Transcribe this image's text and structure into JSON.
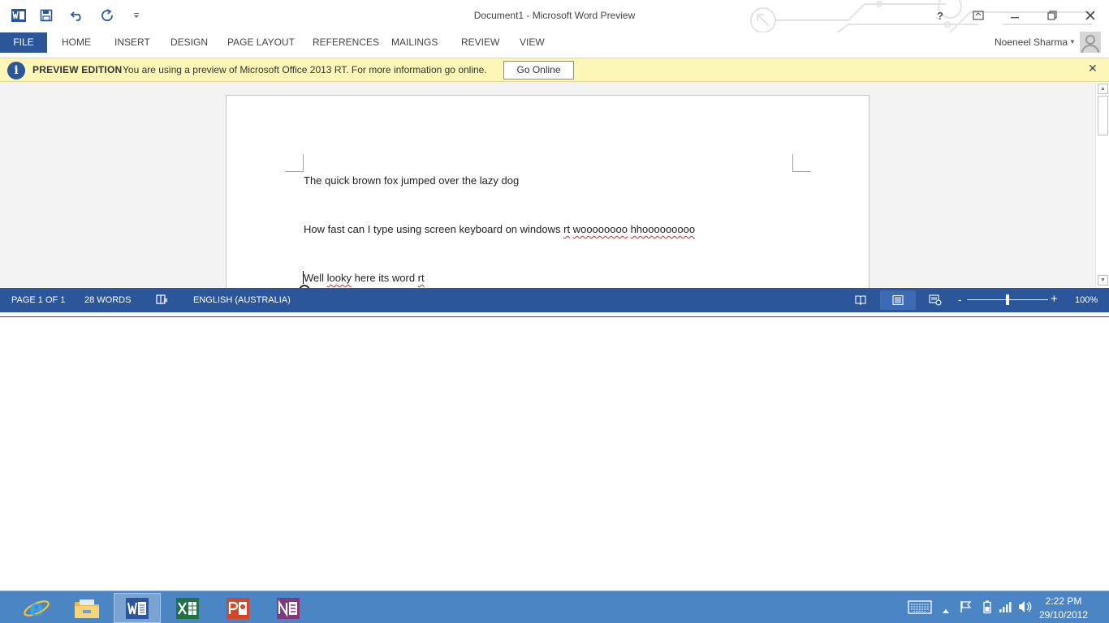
{
  "window": {
    "title": "Document1 - Microsoft Word Preview"
  },
  "ribbon": {
    "tabs": [
      {
        "label": "FILE"
      },
      {
        "label": "HOME"
      },
      {
        "label": "INSERT"
      },
      {
        "label": "DESIGN"
      },
      {
        "label": "PAGE LAYOUT"
      },
      {
        "label": "REFERENCES"
      },
      {
        "label": "MAILINGS"
      },
      {
        "label": "REVIEW"
      },
      {
        "label": "VIEW"
      }
    ],
    "user_name": "Noeneel Sharma"
  },
  "infobar": {
    "title": "PREVIEW EDITION",
    "message": "You are using a preview of Microsoft Office 2013 RT. For more information go online.",
    "button_label": "Go Online",
    "icon": "info-icon"
  },
  "document": {
    "paragraphs": [
      [
        {
          "text": "The quick brown fox jumped over the lazy dog",
          "spell": false
        }
      ],
      [
        {
          "text": "How fast can I type using screen keyboard on windows ",
          "spell": false
        },
        {
          "text": "rt",
          "spell": true
        },
        {
          "text": " ",
          "spell": false
        },
        {
          "text": "woooooooo",
          "spell": true
        },
        {
          "text": " ",
          "spell": false
        },
        {
          "text": "hhooooooooo",
          "spell": true
        }
      ],
      [
        {
          "text": "Well ",
          "spell": false
        },
        {
          "text": "looky",
          "spell": true
        },
        {
          "text": " here its word ",
          "spell": false
        },
        {
          "text": "rt",
          "spell": true
        }
      ]
    ]
  },
  "statusbar": {
    "page": "PAGE 1 OF 1",
    "words": "28 WORDS",
    "language": "ENGLISH (AUSTRALIA)",
    "zoom_minus": "-",
    "zoom_plus": "+",
    "zoom": "100%",
    "zoom_level_percent": 100
  },
  "taskbar": {
    "apps": [
      {
        "name": "internet-explorer",
        "active": false
      },
      {
        "name": "file-explorer",
        "active": false
      },
      {
        "name": "word",
        "active": true
      },
      {
        "name": "excel",
        "active": false
      },
      {
        "name": "powerpoint",
        "active": false
      },
      {
        "name": "onenote",
        "active": false
      }
    ],
    "time": "2:22 PM",
    "date": "29/10/2012"
  },
  "colors": {
    "word_blue": "#2b579a",
    "excel_green": "#217346",
    "powerpoint_orange": "#d24726",
    "onenote_purple": "#80397b",
    "taskbar": "#4b85c3",
    "infobar": "#fcf7b6"
  }
}
